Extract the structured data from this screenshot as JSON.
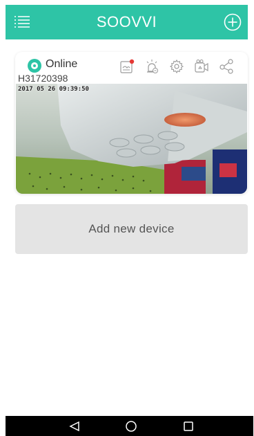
{
  "header": {
    "title": "SOOVVI",
    "menu_icon": "menu-icon",
    "add_icon": "plus-circle-icon",
    "bg_color": "#2ec4a6"
  },
  "device": {
    "status": "Online",
    "id": "H31720398",
    "osd_timestamp": "2017 05 26 09:39:50",
    "tools": [
      "sd-card-icon",
      "alarm-icon",
      "gear-icon",
      "video-camera-icon",
      "share-icon"
    ]
  },
  "add_device": {
    "label": "Add new device"
  },
  "navbar": {
    "back_icon": "back-triangle-icon",
    "home_icon": "home-circle-icon",
    "recent_icon": "recent-square-icon"
  }
}
